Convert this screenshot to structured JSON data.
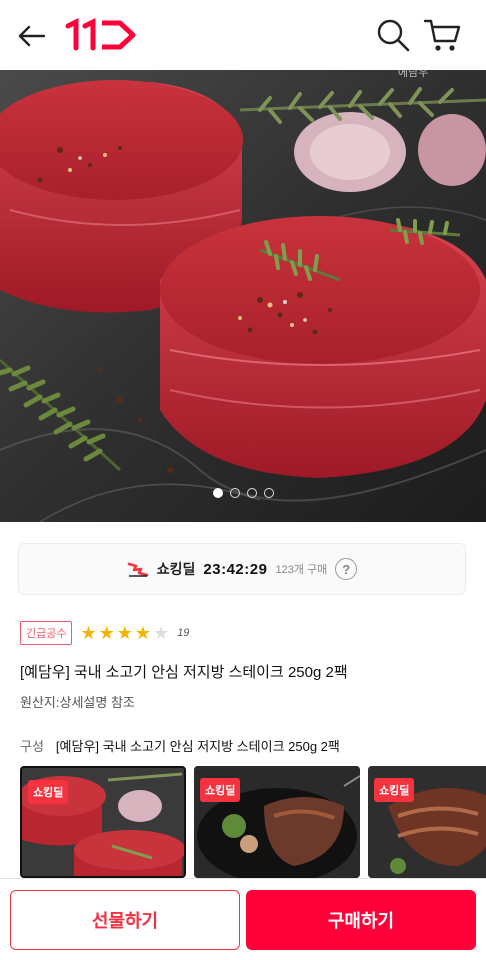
{
  "header": {
    "back_icon": "arrow-left-icon",
    "logo_text": "11",
    "search_icon": "search-icon",
    "cart_icon": "cart-icon",
    "accent_color": "#ff0038"
  },
  "hero": {
    "image_subject": "two raw beef tenderloin steaks with rosemary and garlic",
    "watermark": "에담우",
    "slides": 4,
    "active_slide": 1
  },
  "deal": {
    "label": "쇼킹딜",
    "timer": "23:42:29",
    "purchase_count": "123개 구매",
    "help_label": "?"
  },
  "product": {
    "badge": "긴급공수",
    "rating": 4,
    "rating_max": 5,
    "review_count": "19",
    "title": "[예담우] 국내 소고기 안심 저지방 스테이크 250g 2팩",
    "origin": "원산지:상세설명 참조",
    "composition_label": "구성",
    "composition_value": "[예담우] 국내 소고기 안심 저지방 스테이크 250g 2팩"
  },
  "thumbnails": [
    {
      "badge": "쇼킹딜",
      "selected": true
    },
    {
      "badge": "쇼킹딜",
      "selected": false
    },
    {
      "badge": "쇼킹딜",
      "selected": false
    }
  ],
  "actions": {
    "gift_label": "선물하기",
    "buy_label": "구매하기"
  }
}
